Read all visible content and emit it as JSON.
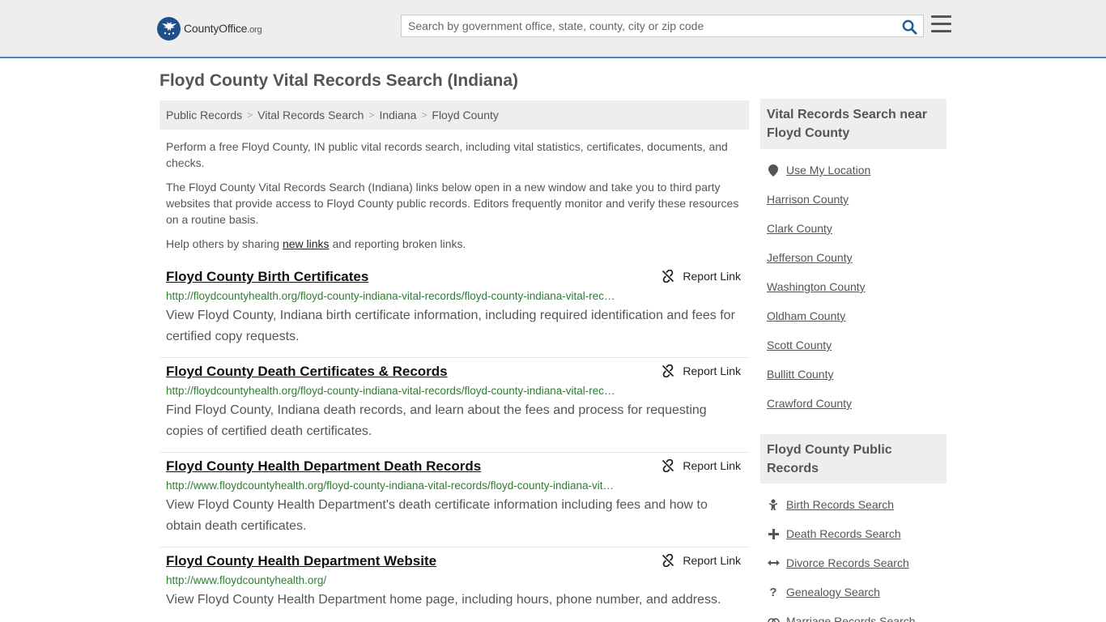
{
  "header": {
    "logo_text": "CountyOffice",
    "logo_suffix": ".org",
    "search_placeholder": "Search by government office, state, county, city or zip code"
  },
  "page": {
    "title": "Floyd County Vital Records Search (Indiana)"
  },
  "breadcrumb": [
    "Public Records",
    "Vital Records Search",
    "Indiana",
    "Floyd County"
  ],
  "intro": {
    "p1": "Perform a free Floyd County, IN public vital records search, including vital statistics, certificates, documents, and checks.",
    "p2": "The Floyd County Vital Records Search (Indiana) links below open in a new window and take you to third party websites that provide access to Floyd County public records. Editors frequently monitor and verify these resources on a routine basis.",
    "p3_before": "Help others by sharing ",
    "p3_link": "new links",
    "p3_after": " and reporting broken links."
  },
  "report_label": "Report Link",
  "results": [
    {
      "title": "Floyd County Birth Certificates",
      "url": "http://floydcountyhealth.org/floyd-county-indiana-vital-records/floyd-county-indiana-vital-rec…",
      "desc": "View Floyd County, Indiana birth certificate information, including required identification and fees for certified copy requests."
    },
    {
      "title": "Floyd County Death Certificates & Records",
      "url": "http://floydcountyhealth.org/floyd-county-indiana-vital-records/floyd-county-indiana-vital-rec…",
      "desc": "Find Floyd County, Indiana death records, and learn about the fees and process for requesting copies of certified death certificates."
    },
    {
      "title": "Floyd County Health Department Death Records",
      "url": "http://www.floydcountyhealth.org/floyd-county-indiana-vital-records/floyd-county-indiana-vit…",
      "desc": "View Floyd County Health Department's death certificate information including fees and how to obtain death certificates."
    },
    {
      "title": "Floyd County Health Department Website",
      "url": "http://www.floydcountyhealth.org/",
      "desc": "View Floyd County Health Department home page, including hours, phone number, and address."
    }
  ],
  "sidebar": {
    "nearby_heading": "Vital Records Search near Floyd County",
    "use_location": "Use My Location",
    "nearby": [
      "Harrison County",
      "Clark County",
      "Jefferson County",
      "Washington County",
      "Oldham County",
      "Scott County",
      "Bullitt County",
      "Crawford County"
    ],
    "public_heading": "Floyd County Public Records",
    "public_records": [
      {
        "label": "Birth Records Search",
        "icon": "baby-icon"
      },
      {
        "label": "Death Records Search",
        "icon": "cross-icon"
      },
      {
        "label": "Divorce Records Search",
        "icon": "arrows-apart-icon"
      },
      {
        "label": "Genealogy Search",
        "icon": "question-icon"
      },
      {
        "label": "Marriage Records Search",
        "icon": "rings-icon"
      }
    ]
  },
  "colors": {
    "accent": "#4a87c4",
    "url_green": "#2e7d32",
    "panel_gray": "#eeeeee",
    "logo_blue": "#1f4f8a"
  }
}
